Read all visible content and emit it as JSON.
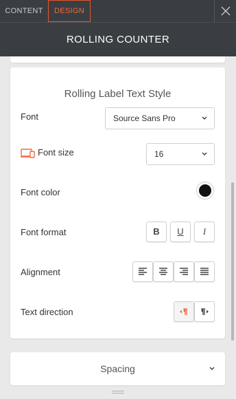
{
  "tabs": {
    "content_label": "CONTENT",
    "design_label": "DESIGN"
  },
  "header": {
    "title": "ROLLING COUNTER"
  },
  "section": {
    "title": "Rolling Label Text Style",
    "font": {
      "label": "Font",
      "value": "Source Sans Pro"
    },
    "font_size": {
      "label": "Font size",
      "value": "16"
    },
    "font_color": {
      "label": "Font color",
      "value": "#111111"
    },
    "font_format": {
      "label": "Font format",
      "bold": "B",
      "underline": "U",
      "italic": "I"
    },
    "alignment": {
      "label": "Alignment",
      "options": [
        "align-left-icon",
        "align-center-icon",
        "align-right-icon",
        "align-justify-icon"
      ]
    },
    "text_direction": {
      "label": "Text direction",
      "selected": "rtl"
    }
  },
  "spacing": {
    "label": "Spacing"
  },
  "colors": {
    "accent": "#f26a3f",
    "header_bg": "#3a3e42",
    "panel_bg": "#e9e9e9"
  }
}
